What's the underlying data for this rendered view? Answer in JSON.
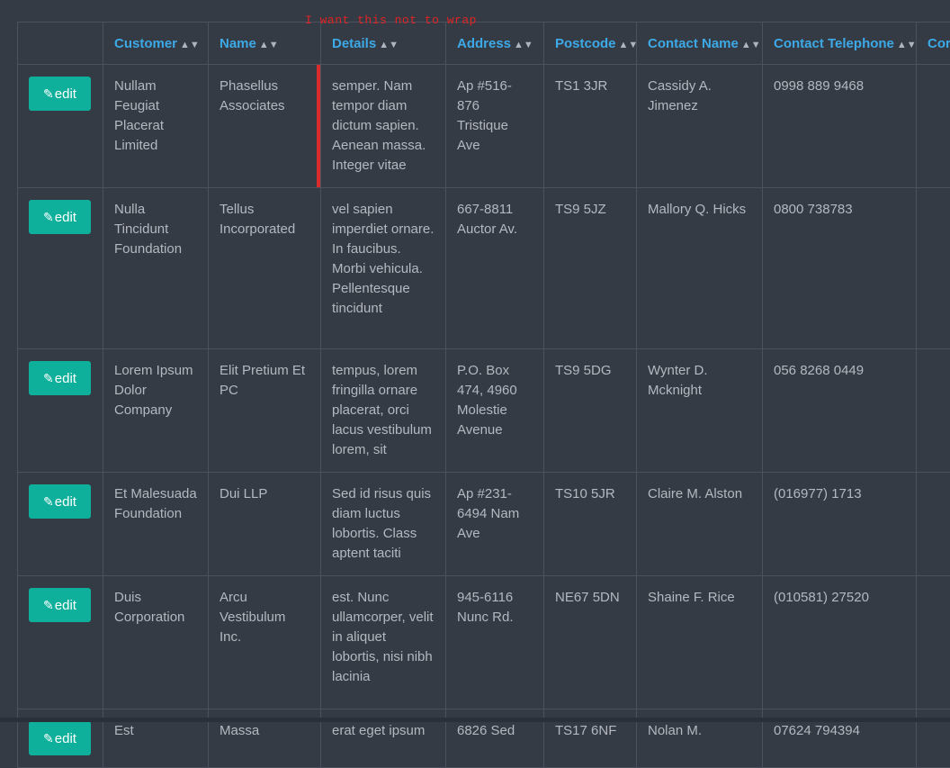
{
  "annotation": "I want this not to wrap",
  "columns": [
    {
      "label": "",
      "sortable": false
    },
    {
      "label": "Customer",
      "sortable": true
    },
    {
      "label": "Name",
      "sortable": true
    },
    {
      "label": "Details",
      "sortable": true
    },
    {
      "label": "Address",
      "sortable": true
    },
    {
      "label": "Postcode",
      "sortable": true
    },
    {
      "label": "Contact Name",
      "sortable": true
    },
    {
      "label": "Contact Telephone",
      "sortable": true
    },
    {
      "label": "Cor",
      "sortable": false
    }
  ],
  "sort_icon": "sort-icon",
  "edit_label": "edit",
  "edit_icon": "edit-icon",
  "accent_color": "#0fb09b",
  "header_color": "#3da9e6",
  "rows": [
    {
      "customer": "Nullam Feugiat Placerat Limited",
      "name": "Phasellus Associates",
      "details": "semper. Nam tempor diam dictum sapien. Aenean massa. Integer vitae",
      "address": "Ap #516-876 Tristique Ave",
      "postcode": "TS1 3JR",
      "contact_name": "Cassidy A. Jimenez",
      "contact_telephone": "0998 889 9468"
    },
    {
      "customer": "Nulla Tincidunt Foundation",
      "name": "Tellus Incorporated",
      "details": "vel sapien imperdiet ornare. In faucibus. Morbi vehicula. Pellentesque tincidunt",
      "address": "667-8811 Auctor Av.",
      "postcode": "TS9 5JZ",
      "contact_name": "Mallory Q. Hicks",
      "contact_telephone": "0800 738783"
    },
    {
      "customer": "Lorem Ipsum Dolor Company",
      "name": "Elit Pretium Et PC",
      "details": "tempus, lorem fringilla ornare placerat, orci lacus vestibulum lorem, sit",
      "address": "P.O. Box 474, 4960 Molestie Avenue",
      "postcode": "TS9 5DG",
      "contact_name": "Wynter D. Mcknight",
      "contact_telephone": "056 8268 0449"
    },
    {
      "customer": "Et Malesuada Foundation",
      "name": "Dui LLP",
      "details": "Sed id risus quis diam luctus lobortis. Class aptent taciti",
      "address": "Ap #231-6494 Nam Ave",
      "postcode": "TS10 5JR",
      "contact_name": "Claire M. Alston",
      "contact_telephone": "(016977) 1713"
    },
    {
      "customer": "Duis Corporation",
      "name": "Arcu Vestibulum Inc.",
      "details": "est. Nunc ullamcorper, velit in aliquet lobortis, nisi nibh lacinia",
      "address": "945-6116 Nunc Rd.",
      "postcode": "NE67 5DN",
      "contact_name": "Shaine F. Rice",
      "contact_telephone": "(010581) 27520"
    },
    {
      "customer": "Est",
      "name": "Massa",
      "details": "erat eget ipsum",
      "address": "6826 Sed",
      "postcode": "TS17 6NF",
      "contact_name": "Nolan M.",
      "contact_telephone": "07624 794394"
    }
  ]
}
